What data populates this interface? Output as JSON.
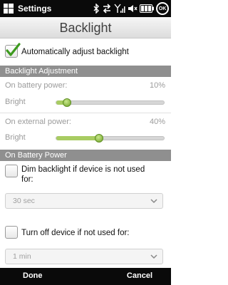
{
  "status": {
    "app_name": "Settings",
    "ok_label": "OK"
  },
  "title": "Backlight",
  "auto_adjust": {
    "label": "Automatically adjust backlight",
    "checked": true
  },
  "backlight_adjustment": {
    "header": "Backlight Adjustment",
    "battery": {
      "label": "On battery power:",
      "value_text": "10%",
      "value": 0.1,
      "slider_label": "Bright"
    },
    "external": {
      "label": "On external power:",
      "value_text": "40%",
      "value": 0.4,
      "slider_label": "Bright"
    }
  },
  "on_battery_power": {
    "header": "On Battery Power",
    "dim": {
      "label": "Dim backlight if device is not used for:",
      "checked": false,
      "selected": "30 sec"
    },
    "turn_off": {
      "label": "Turn off device if not used for:",
      "checked": false,
      "selected": "1 min"
    }
  },
  "softkeys": {
    "left": "Done",
    "right": "Cancel"
  },
  "colors": {
    "accent_green": "#a8cc62",
    "check_green": "#3d9a1e",
    "section_grey": "#8f8f8f"
  },
  "icons": [
    "windows-start-icon",
    "bluetooth-icon",
    "data-sync-icon",
    "signal-icon",
    "volume-icon",
    "battery-icon",
    "ok-button",
    "chevron-down-icon",
    "checkmark-icon"
  ]
}
